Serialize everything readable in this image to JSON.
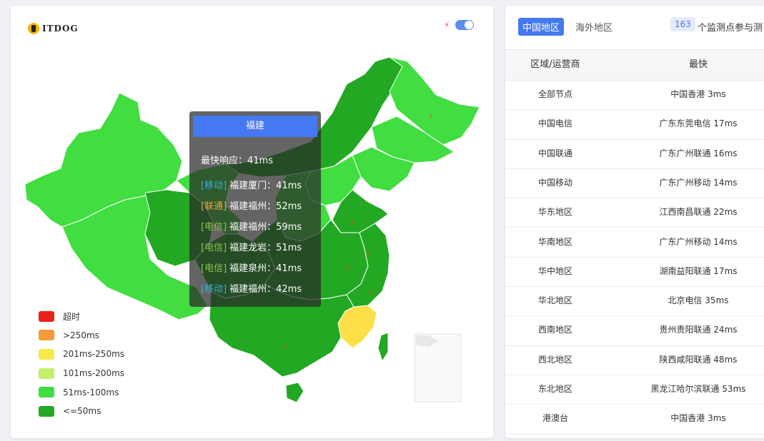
{
  "map": {
    "logo_text": "ITDOG",
    "tooltip": {
      "province": "福建",
      "fastest": "最快响应：41ms",
      "rows": [
        {
          "tag": "[移动]",
          "text": "福建厦门：41ms",
          "color": "#35b1d6"
        },
        {
          "tag": "[联通]",
          "text": "福建福州：52ms",
          "color": "#f2a33a"
        },
        {
          "tag": "[电信]",
          "text": "福建福州：59ms",
          "color": "#8bc34a"
        },
        {
          "tag": "[电信]",
          "text": "福建龙岩：51ms",
          "color": "#8bc34a"
        },
        {
          "tag": "[电信]",
          "text": "福建泉州：41ms",
          "color": "#8bc34a"
        },
        {
          "tag": "[移动]",
          "text": "福建福州：42ms",
          "color": "#35b1d6"
        }
      ]
    },
    "legend": [
      {
        "label": "超时",
        "color": "#e8211d"
      },
      {
        "label": ">250ms",
        "color": "#f59a38"
      },
      {
        "label": "201ms-250ms",
        "color": "#f7e94a"
      },
      {
        "label": "101ms-200ms",
        "color": "#c2f06a"
      },
      {
        "label": "51ms-100ms",
        "color": "#41dd41"
      },
      {
        "label": "<=50ms",
        "color": "#23a823"
      }
    ],
    "colors": {
      "dark_green": "#23a823",
      "light_green": "#41dd41",
      "yellow": "#fde047",
      "bolt": "#ff3b30"
    }
  },
  "panel": {
    "tabs": [
      {
        "label": "中国地区",
        "active": true
      },
      {
        "label": "海外地区",
        "active": false
      }
    ],
    "count": "163",
    "count_label": "个监测点参与测",
    "headers": [
      "区域/运营商",
      "最快"
    ],
    "rows": [
      [
        "全部节点",
        "中国香港 3ms"
      ],
      [
        "中国电信",
        "广东东莞电信 17ms"
      ],
      [
        "中国联通",
        "广东广州联通 16ms"
      ],
      [
        "中国移动",
        "广东广州移动 14ms"
      ],
      [
        "华东地区",
        "江西南昌联通 22ms"
      ],
      [
        "华南地区",
        "广东广州移动 14ms"
      ],
      [
        "华中地区",
        "湖南益阳联通 17ms"
      ],
      [
        "华北地区",
        "北京电信 35ms"
      ],
      [
        "西南地区",
        "贵州贵阳联通 24ms"
      ],
      [
        "西北地区",
        "陕西咸阳联通 48ms"
      ],
      [
        "东北地区",
        "黑龙江哈尔滨联通 53ms"
      ],
      [
        "港澳台",
        "中国香港 3ms"
      ]
    ]
  }
}
